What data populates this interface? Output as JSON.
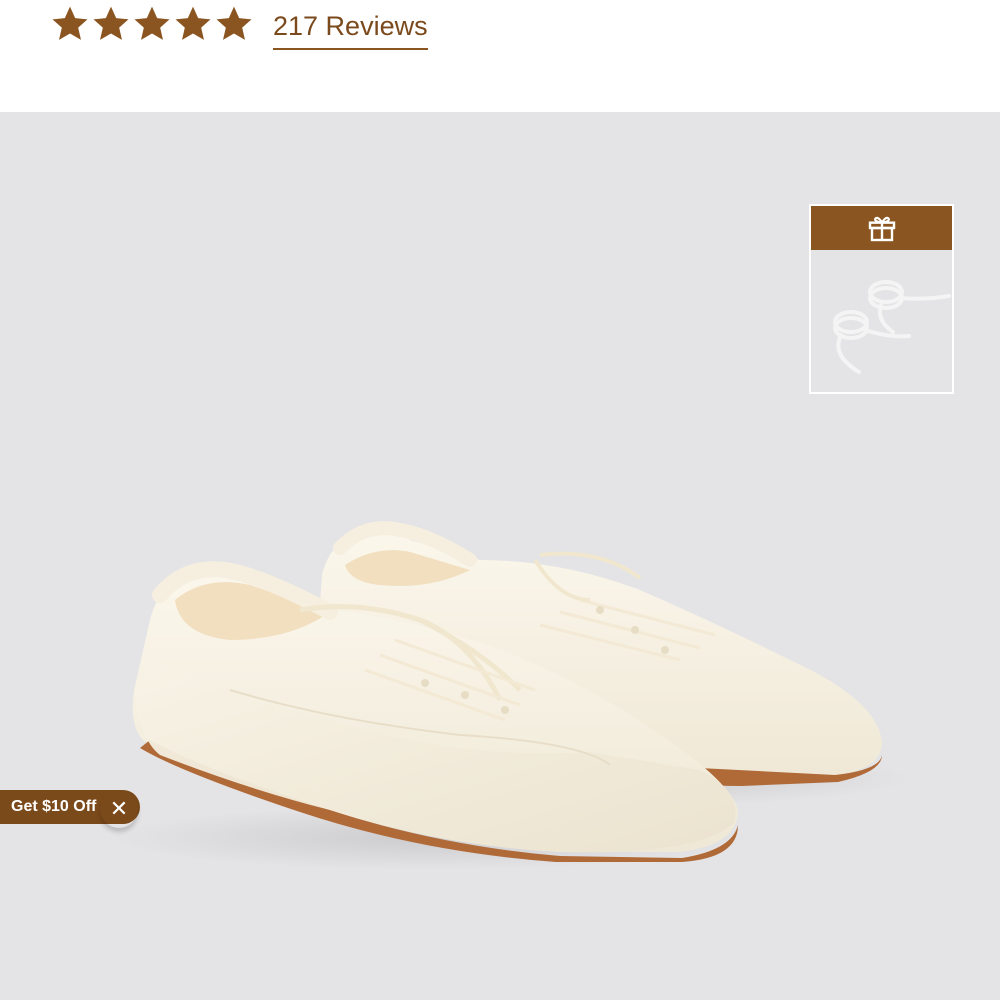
{
  "rating": {
    "stars_filled": 5,
    "stars_total": 5,
    "star_color": "#8a5520"
  },
  "reviews": {
    "label": "217 Reviews",
    "color": "#7a4a1c"
  },
  "gallery": {
    "background": "#e4e4e6",
    "product_image_name": "cream-nylon-lace-up-sneakers-pair",
    "gift_badge": {
      "icon": "gift-icon",
      "header_color": "#8a5520",
      "thumbnail": "white-shoelaces"
    }
  },
  "promo": {
    "label": "Get $10 Off",
    "close_icon": "close-icon",
    "close_glyph": "✕",
    "color": "#7b4a1b"
  }
}
